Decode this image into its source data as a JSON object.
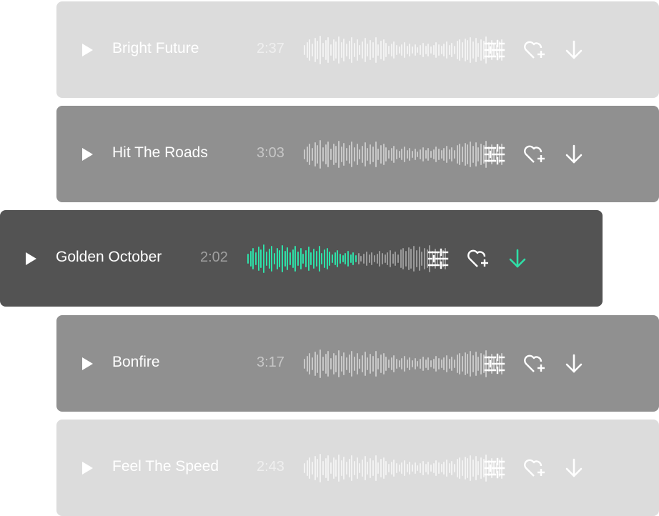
{
  "tracks": [
    {
      "title": "Bright Future",
      "duration": "2:37",
      "state": "faded",
      "colors": {
        "text": "#ffffff",
        "duration": "#efefef",
        "wave": "#f2f2f2",
        "icons": "#ffffff"
      },
      "progress": 0
    },
    {
      "title": "Hit The Roads",
      "duration": "3:03",
      "state": "dimmed",
      "colors": {
        "text": "#ffffff",
        "duration": "#c6c6c6",
        "wave": "#c8c8c8",
        "icons": "#ffffff"
      },
      "progress": 0
    },
    {
      "title": "Golden October",
      "duration": "2:02",
      "state": "active",
      "colors": {
        "text": "#ffffff",
        "duration": "#a0a0a0",
        "wave": "#9a9a9a",
        "wave_played": "#2ee0a8",
        "icons": "#ffffff",
        "download_icon": "#2ee0a8"
      },
      "progress": 0.55
    },
    {
      "title": "Bonfire",
      "duration": "3:17",
      "state": "dimmed",
      "colors": {
        "text": "#ffffff",
        "duration": "#c6c6c6",
        "wave": "#c8c8c8",
        "icons": "#ffffff"
      },
      "progress": 0
    },
    {
      "title": "Feel The Speed",
      "duration": "2:43",
      "state": "faded",
      "colors": {
        "text": "#ffffff",
        "duration": "#efefef",
        "wave": "#f2f2f2",
        "icons": "#ffffff"
      },
      "progress": 0
    }
  ],
  "icons": {
    "play": "play-icon",
    "equalizer": "sliders-icon",
    "favorite": "heart-plus-icon",
    "download": "download-arrow-icon"
  },
  "accent": "#2ee0a8"
}
